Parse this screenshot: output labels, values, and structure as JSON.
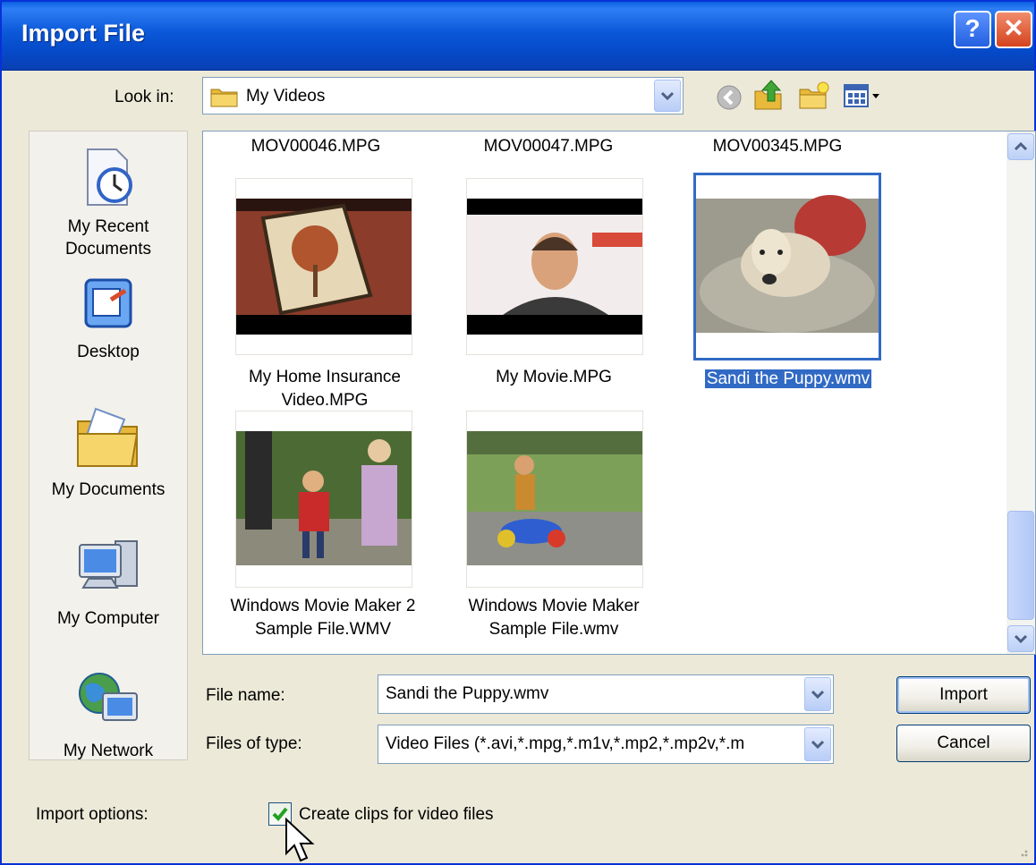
{
  "window": {
    "title": "Import File"
  },
  "toolbar": {
    "look_in_label": "Look in:",
    "look_in_value": "My Videos"
  },
  "places": [
    {
      "label": "My Recent Documents",
      "line1": "My Recent",
      "line2": "Documents",
      "icon": "recent-documents-icon"
    },
    {
      "label": "Desktop",
      "icon": "desktop-icon"
    },
    {
      "label": "My Documents",
      "icon": "my-documents-icon"
    },
    {
      "label": "My Computer",
      "icon": "my-computer-icon"
    },
    {
      "label": "My Network",
      "icon": "my-network-icon"
    }
  ],
  "files": {
    "top_row": [
      "MOV00046.MPG",
      "MOV00047.MPG",
      "MOV00345.MPG"
    ],
    "items": [
      {
        "line1": "My Home Insurance",
        "line2": "Video.MPG",
        "selected": false
      },
      {
        "line1": "My Movie.MPG",
        "line2": "",
        "selected": false
      },
      {
        "line1": "Sandi the Puppy.wmv",
        "line2": "",
        "selected": true
      },
      {
        "line1": "Windows Movie Maker 2",
        "line2": "Sample File.WMV",
        "selected": false
      },
      {
        "line1": "Windows Movie Maker",
        "line2": "Sample File.wmv",
        "selected": false
      }
    ]
  },
  "form": {
    "file_name_label": "File name:",
    "file_name_value": "Sandi the Puppy.wmv",
    "files_of_type_label": "Files of type:",
    "files_of_type_value": "Video Files (*.avi,*.mpg,*.m1v,*.mp2,*.mp2v,*.m"
  },
  "buttons": {
    "import": "Import",
    "cancel": "Cancel"
  },
  "options": {
    "label": "Import options:",
    "create_clips": "Create clips for video files",
    "create_clips_checked": true
  }
}
